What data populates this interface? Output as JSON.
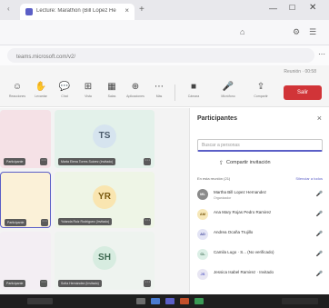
{
  "browser": {
    "tab_title": "Lecture: Marathon (Bill Lopez Hernandez) | Microsoft Teams",
    "tab_close": "×",
    "new_tab": "+",
    "back_icon": "‹",
    "window_controls": {
      "minimize": "—",
      "maximize": "☐",
      "close": "✕"
    },
    "url_text": "teams.microsoft.com/v2/",
    "more_icon": "⋯"
  },
  "meeting": {
    "top_hint": "Reunión · 00:58",
    "toolbar": [
      {
        "id": "reactions",
        "icon": "☺",
        "label": "Reacciones"
      },
      {
        "id": "raise-hand",
        "icon": "✋",
        "label": "Levantar"
      },
      {
        "id": "chat",
        "icon": "💬",
        "label": "Chat"
      },
      {
        "id": "view",
        "icon": "⊞",
        "label": "Vista"
      },
      {
        "id": "rooms",
        "icon": "▦",
        "label": "Salas"
      },
      {
        "id": "apps",
        "icon": "⊕",
        "label": "Aplicaciones"
      },
      {
        "id": "more",
        "icon": "⋯",
        "label": "Más"
      },
      {
        "id": "camera",
        "icon": "■",
        "label": "Cámara"
      },
      {
        "id": "mic",
        "icon": "🎤",
        "label": "Micrófono"
      },
      {
        "id": "share",
        "icon": "⇪",
        "label": "Compartir"
      }
    ],
    "leave_label": "Salir",
    "tiles": [
      {
        "initials": "",
        "name": "Participante",
        "bg": "#f5e1e6"
      },
      {
        "initials": "TS",
        "name": "Marta Elena Torres Suárez (Invitado)",
        "bg": "#e3f1ea",
        "circle": "#d6e4ef",
        "fg": "#4a5a6a"
      },
      {
        "initials": "",
        "name": "Participante",
        "bg": "#fbf1d8"
      },
      {
        "initials": "YR",
        "name": "Yolanda Ruiz Rodríguez (Invitado)",
        "bg": "#eef5e6",
        "circle": "#f9e5b0",
        "fg": "#7a5a10"
      },
      {
        "initials": "",
        "name": "Participante",
        "bg": "#f3eef3"
      },
      {
        "initials": "SH",
        "name": "Sofía Hernández (Invitado)",
        "bg": "#eef3ef",
        "circle": "#d7ece0",
        "fg": "#3f6a52"
      }
    ]
  },
  "participants_panel": {
    "title": "Participantes",
    "close_icon": "×",
    "search_placeholder": "Buscar a personas",
    "share_invite": "Compartir invitación",
    "share_icon": "⇪",
    "section_label": "En esta reunión (21)",
    "mute_all": "Silenciar a todos",
    "people": [
      {
        "initials": "ML",
        "name": "Martha Bill Lopez Hernandez",
        "role": "Organizador",
        "avatar_bg": "#8a8a8a",
        "avatar_fg": "#ffffff"
      },
      {
        "initials": "AM",
        "name": "Ana Mary Rojas Pedro Ramirez",
        "role": "",
        "avatar_bg": "#f6e7b8",
        "avatar_fg": "#7a5a10"
      },
      {
        "initials": "AD",
        "name": "Andrea Ocaña Trujillo",
        "role": "",
        "avatar_bg": "#e3e4f5",
        "avatar_fg": "#4a4fa0"
      },
      {
        "initials": "CL",
        "name": "Camila Lugo · S... (No verificado)",
        "role": "",
        "avatar_bg": "#dcefe6",
        "avatar_fg": "#3a6a50"
      },
      {
        "initials": "JS",
        "name": "Jessica Isabel Ramirez · Invitado",
        "role": "",
        "avatar_bg": "#e8e6f3",
        "avatar_fg": "#5b5fc7"
      }
    ],
    "mic_icon": "🎤"
  }
}
